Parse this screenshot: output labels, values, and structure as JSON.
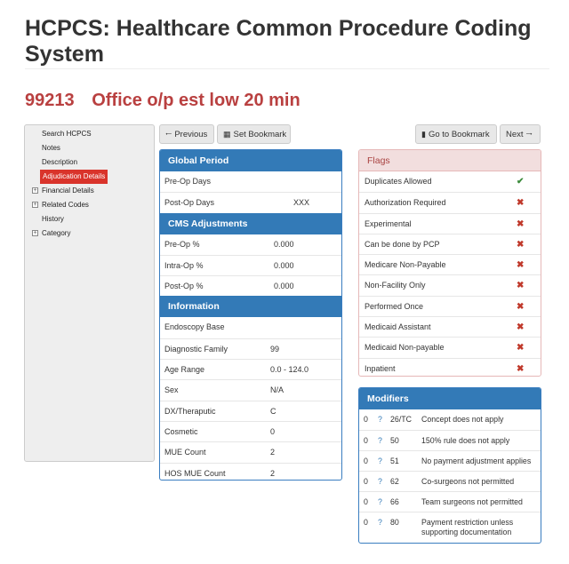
{
  "page": {
    "title": "HCPCS: Healthcare Common Procedure Coding System",
    "code": "99213",
    "description": "Office o/p est low 20 min"
  },
  "sidebar": {
    "items": [
      {
        "label": "Search HCPCS",
        "expandable": false
      },
      {
        "label": "Notes",
        "expandable": false
      },
      {
        "label": "Description",
        "expandable": false
      },
      {
        "label": "Adjudication Details",
        "expandable": false,
        "active": true
      },
      {
        "label": "Financial Details",
        "expandable": true
      },
      {
        "label": "Related Codes",
        "expandable": true
      },
      {
        "label": "History",
        "expandable": false
      },
      {
        "label": "Category",
        "expandable": true
      }
    ],
    "expand_glyph": "+"
  },
  "toolbar": {
    "previous": "Previous",
    "set_bookmark": "Set Bookmark",
    "go_to_bookmark": "Go to Bookmark",
    "next": "Next"
  },
  "global_period": {
    "title": "Global Period",
    "rows": [
      {
        "label": "Pre-Op Days",
        "value": ""
      },
      {
        "label": "Post-Op Days",
        "value": "XXX"
      }
    ]
  },
  "cms_adjustments": {
    "title": "CMS Adjustments",
    "rows": [
      {
        "label": "Pre-Op %",
        "value": "0.000"
      },
      {
        "label": "Intra-Op %",
        "value": "0.000"
      },
      {
        "label": "Post-Op %",
        "value": "0.000"
      }
    ]
  },
  "information": {
    "title": "Information",
    "rows": [
      {
        "label": "Endoscopy Base",
        "value": ""
      },
      {
        "label": "Diagnostic Family",
        "value": "99"
      },
      {
        "label": "Age Range",
        "value": "0.0 - 124.0"
      },
      {
        "label": "Sex",
        "value": "N/A"
      },
      {
        "label": "DX/Theraputic",
        "value": "C"
      },
      {
        "label": "Cosmetic",
        "value": "0"
      },
      {
        "label": "MUE Count",
        "value": "2"
      },
      {
        "label": "HOS MUE Count",
        "value": "2"
      }
    ]
  },
  "flags": {
    "title": "Flags",
    "yes_glyph": "✔",
    "no_glyph": "✖",
    "rows": [
      {
        "label": "Duplicates Allowed",
        "value": true
      },
      {
        "label": "Authorization Required",
        "value": false
      },
      {
        "label": "Experimental",
        "value": false
      },
      {
        "label": "Can be done by PCP",
        "value": false
      },
      {
        "label": "Medicare Non-Payable",
        "value": false
      },
      {
        "label": "Non-Facility Only",
        "value": false
      },
      {
        "label": "Performed Once",
        "value": false
      },
      {
        "label": "Medicaid Assistant",
        "value": false
      },
      {
        "label": "Medicaid Non-payable",
        "value": false
      },
      {
        "label": "Inpatient",
        "value": false
      }
    ]
  },
  "modifiers": {
    "title": "Modifiers",
    "help_glyph": "?",
    "rows": [
      {
        "count": "0",
        "code": "26/TC",
        "description": "Concept does not apply"
      },
      {
        "count": "0",
        "code": "50",
        "description": "150% rule does not apply"
      },
      {
        "count": "0",
        "code": "51",
        "description": "No payment adjustment applies"
      },
      {
        "count": "0",
        "code": "62",
        "description": "Co-surgeons not permitted"
      },
      {
        "count": "0",
        "code": "66",
        "description": "Team surgeons not permitted"
      },
      {
        "count": "0",
        "code": "80",
        "description": "Payment restriction unless supporting documentation"
      }
    ]
  },
  "colors": {
    "accent": "#337ab7",
    "heading_red": "#b94040",
    "active_nav": "#d9342b",
    "flag_yes": "#3c8b3c",
    "flag_no": "#c0392b"
  }
}
